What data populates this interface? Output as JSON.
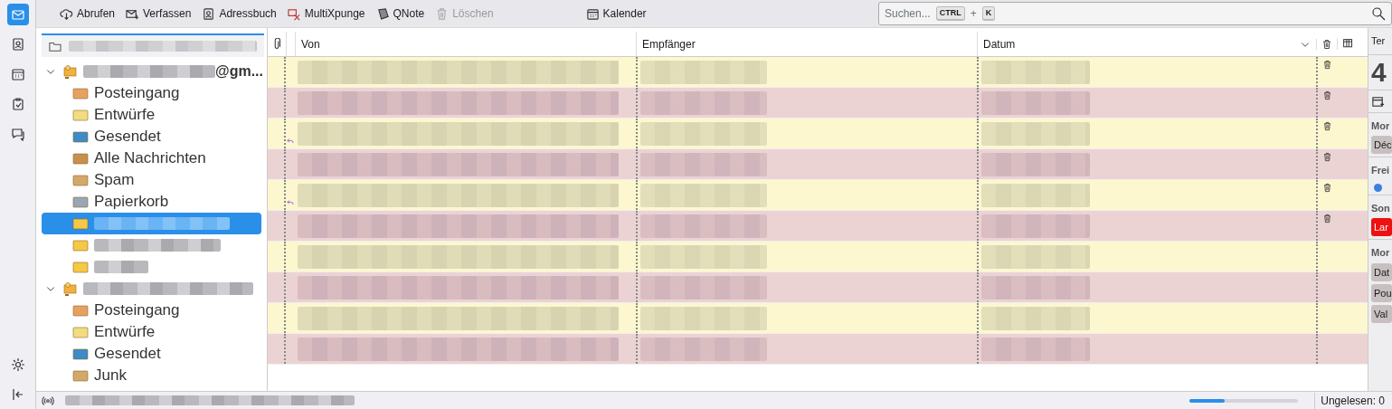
{
  "spaces": [
    {
      "kind": "mail",
      "selected": true
    },
    {
      "kind": "addressbook",
      "selected": false
    },
    {
      "kind": "calendar",
      "selected": false
    },
    {
      "kind": "tasks",
      "selected": false
    },
    {
      "kind": "chat",
      "selected": false
    }
  ],
  "spaces_bottom": [
    {
      "kind": "settings"
    },
    {
      "kind": "collapse"
    }
  ],
  "toolbar": {
    "buttons": [
      {
        "label": "Abrufen",
        "kind": "get",
        "disabled": false
      },
      {
        "label": "Verfassen",
        "kind": "write",
        "disabled": false
      },
      {
        "label": "Adressbuch",
        "kind": "addressbook",
        "disabled": false
      },
      {
        "label": "MultiXpunge",
        "kind": "xpunge",
        "disabled": false
      },
      {
        "label": "QNote",
        "kind": "note",
        "disabled": false
      },
      {
        "label": "Löschen",
        "kind": "delete",
        "disabled": true
      }
    ],
    "center_button": {
      "label": "Kalender",
      "kind": "calendar"
    }
  },
  "search": {
    "placeholder": "Suchen...",
    "keys": [
      "CTRL",
      "K"
    ],
    "joiner": "+"
  },
  "accounts": [
    {
      "name_suffix": "@gm...",
      "expanded": true,
      "folders": [
        {
          "label": "Posteingang",
          "kind": "inbox",
          "selected": false
        },
        {
          "label": "Entwürfe",
          "kind": "drafts",
          "selected": false
        },
        {
          "label": "Gesendet",
          "kind": "sent",
          "selected": false
        },
        {
          "label": "Alle Nachrichten",
          "kind": "archive",
          "selected": false
        },
        {
          "label": "Spam",
          "kind": "junk",
          "selected": false
        },
        {
          "label": "Papierkorb",
          "kind": "trash",
          "selected": false
        },
        {
          "kind": "folder",
          "selected": true
        },
        {
          "kind": "folder",
          "selected": false
        },
        {
          "kind": "folder",
          "selected": false
        }
      ]
    },
    {
      "expanded": true,
      "folders": [
        {
          "label": "Posteingang",
          "kind": "inbox",
          "selected": false
        },
        {
          "label": "Entwürfe",
          "kind": "drafts",
          "selected": false
        },
        {
          "label": "Gesendet",
          "kind": "sent",
          "selected": false
        },
        {
          "label": "Junk",
          "kind": "junk",
          "selected": false
        }
      ]
    }
  ],
  "message_list": {
    "columns": [
      {
        "label": "Von"
      },
      {
        "label": "Empfänger"
      },
      {
        "label": "Datum",
        "sorted": true
      }
    ],
    "rows": [
      {
        "color": "#fcf7cf",
        "replied": false,
        "trash": true
      },
      {
        "color": "#ecd3d3",
        "replied": false,
        "trash": true
      },
      {
        "color": "#fcf7cf",
        "replied": true,
        "trash": true
      },
      {
        "color": "#ecd3d3",
        "replied": false,
        "trash": true
      },
      {
        "color": "#fcf7cf",
        "replied": true,
        "trash": true
      },
      {
        "color": "#ecd3d3",
        "replied": false,
        "trash": true
      },
      {
        "color": "#fcf7cf",
        "replied": false,
        "trash": false
      },
      {
        "color": "#ecd3d3",
        "replied": false,
        "trash": false
      },
      {
        "color": "#fcf7cf",
        "replied": false,
        "trash": false
      },
      {
        "color": "#ecd3d3",
        "replied": false,
        "trash": false
      }
    ]
  },
  "today_pane": {
    "header": "Ter",
    "day": "4",
    "sections": [
      {
        "title": "Mor",
        "items": [
          {
            "kind": "event",
            "label": "Déc"
          }
        ]
      },
      {
        "title": "Frei",
        "items": [
          {
            "kind": "dot",
            "color": "#3a7fe0"
          }
        ]
      },
      {
        "title": "Son",
        "items": [
          {
            "kind": "alert",
            "label": "Lar"
          }
        ]
      },
      {
        "title": "Mor",
        "items": [
          {
            "kind": "event",
            "label": "Dat"
          },
          {
            "kind": "event",
            "label": "Pou"
          },
          {
            "kind": "event",
            "label": "Val"
          }
        ]
      }
    ]
  },
  "status_bar": {
    "level": 0.32,
    "unread": "Ungelesen: 0"
  }
}
